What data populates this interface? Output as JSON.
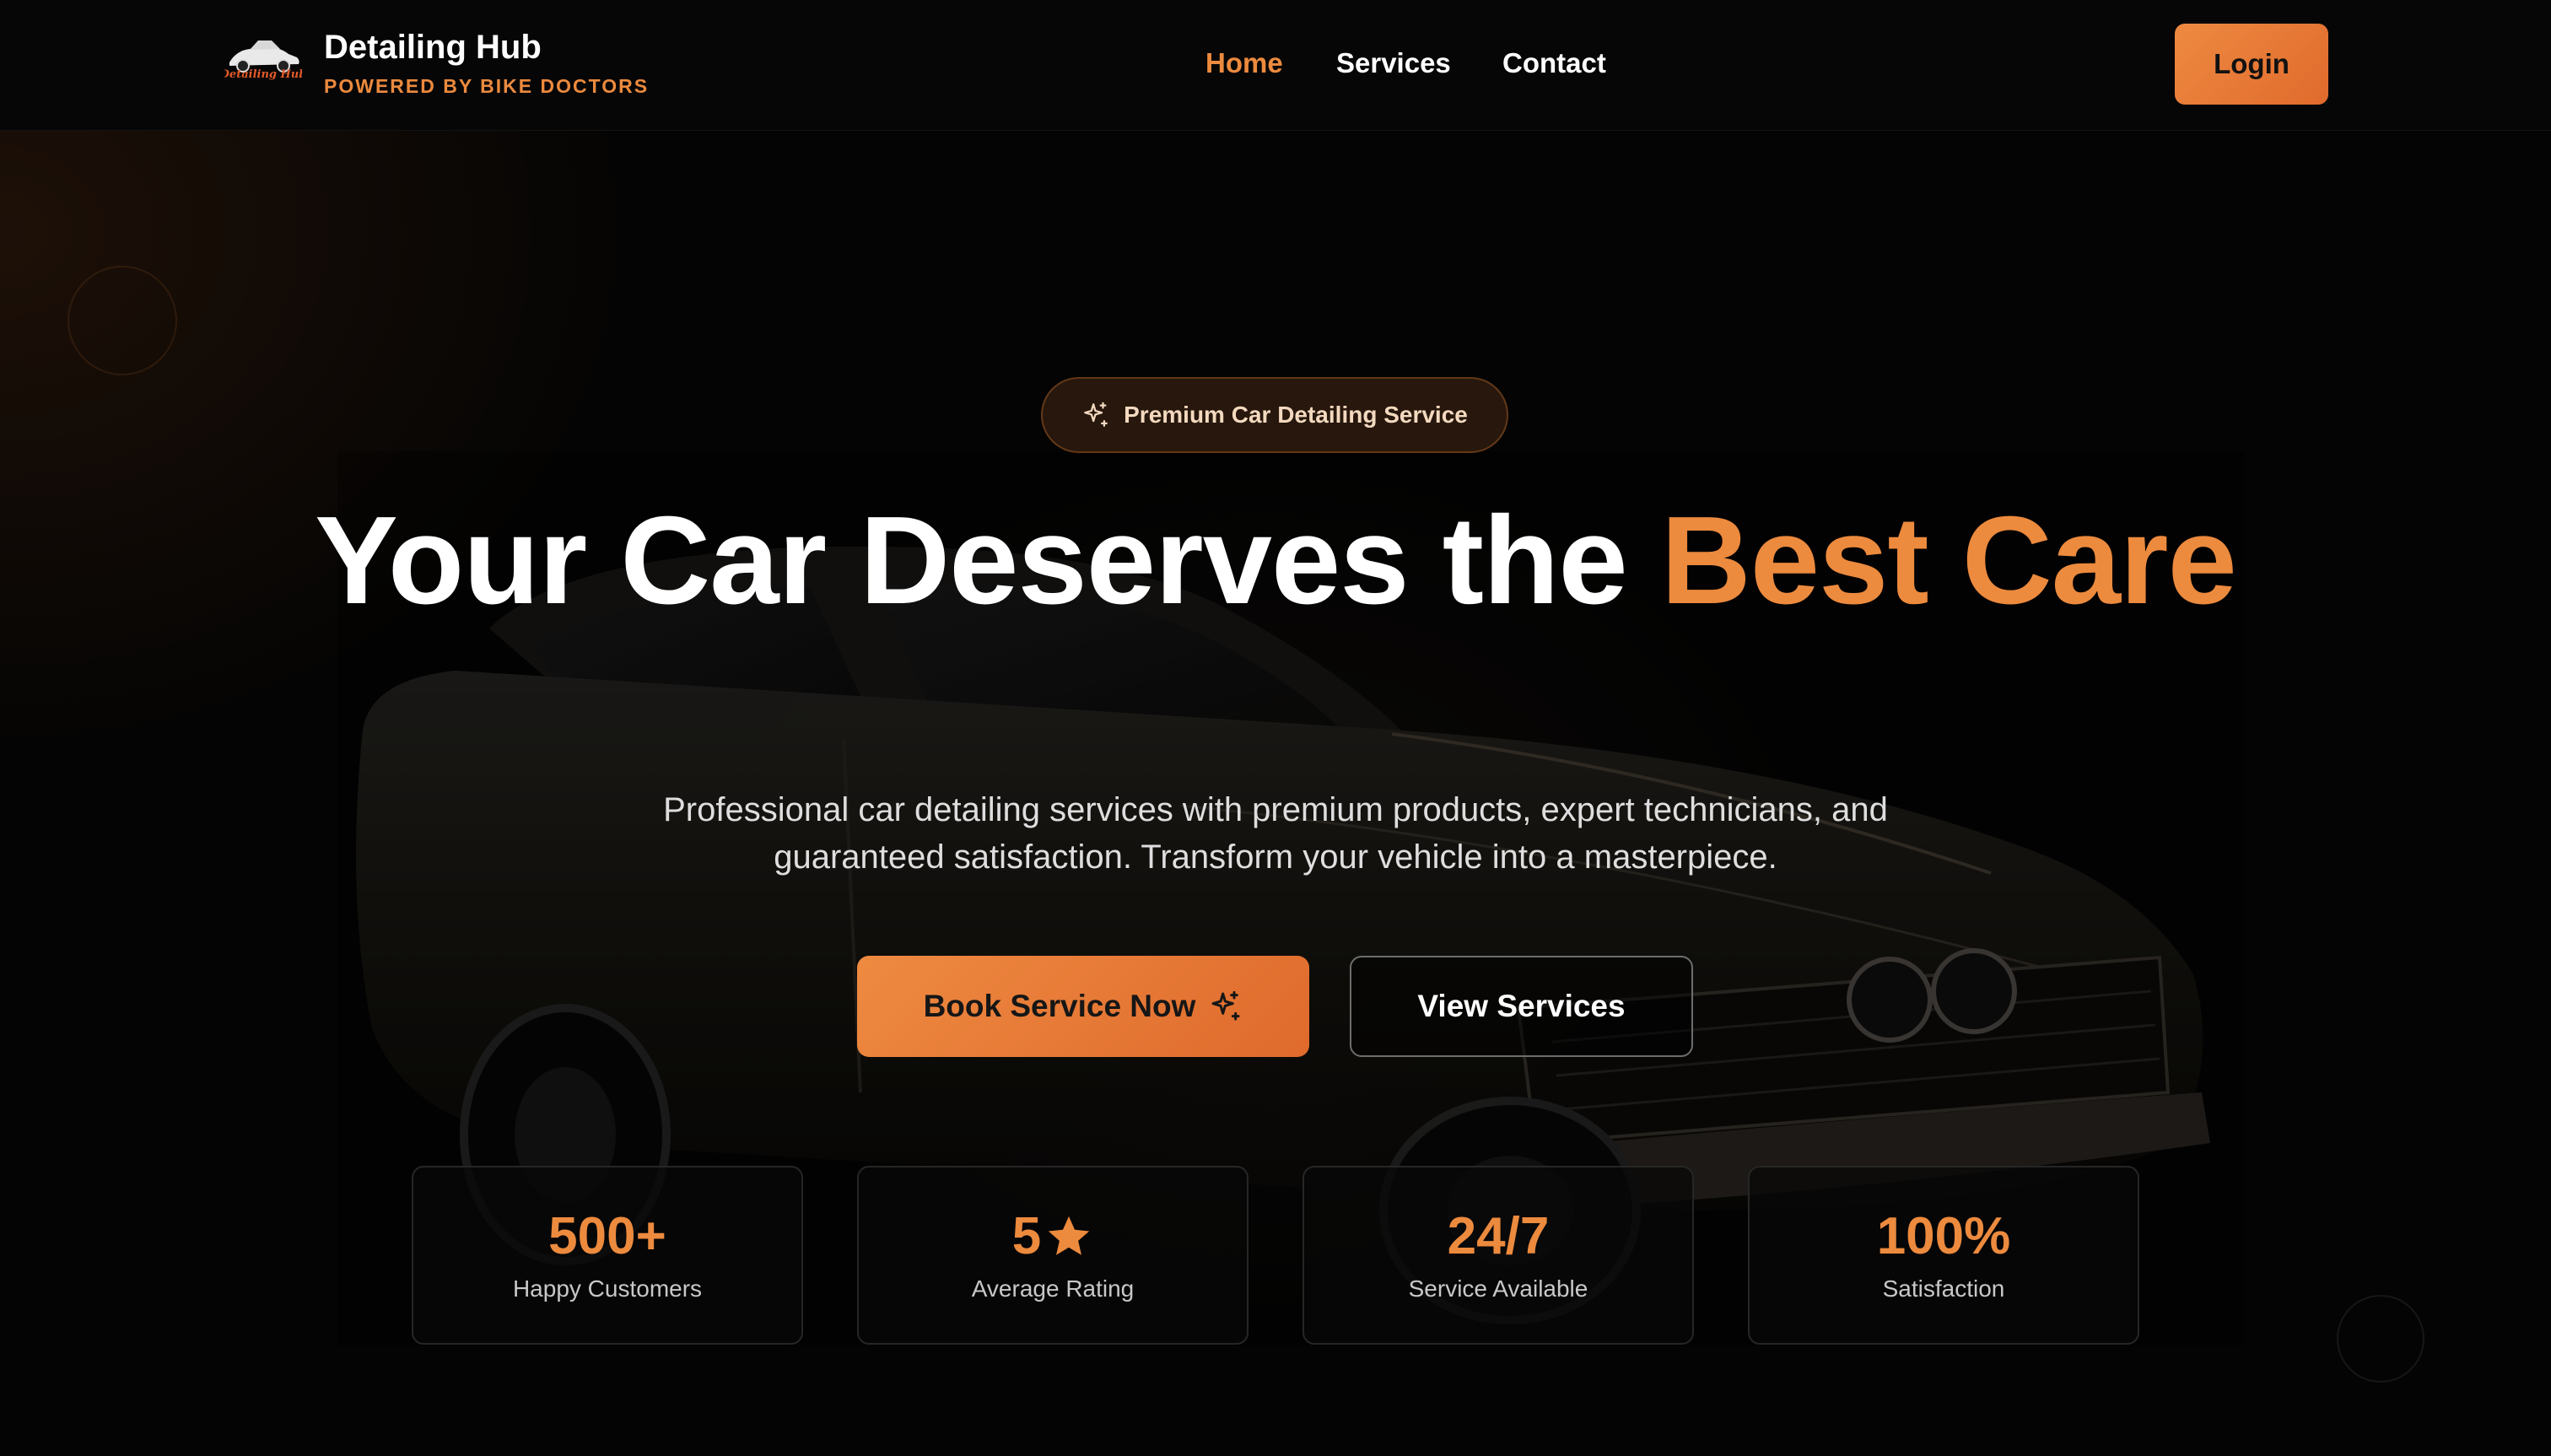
{
  "brand": {
    "name": "Detailing Hub",
    "tagline": "POWERED BY BIKE DOCTORS",
    "logo_icon": "car-logo-icon",
    "logo_text": "Detailing Hub"
  },
  "nav": {
    "links": [
      {
        "label": "Home",
        "active": true
      },
      {
        "label": "Services",
        "active": false
      },
      {
        "label": "Contact",
        "active": false
      }
    ],
    "login_label": "Login"
  },
  "hero": {
    "badge": {
      "icon": "sparkles-icon",
      "label": "Premium Car Detailing Service"
    },
    "headline_main": "Your Car Deserves the",
    "headline_accent": "Best Care",
    "description": "Professional car detailing services with premium products, expert technicians, and guaranteed satisfaction. Transform your vehicle into a masterpiece.",
    "primary_button": {
      "label": "Book Service Now",
      "icon": "sparkles-icon"
    },
    "secondary_button": {
      "label": "View Services"
    },
    "background_image": "classic-car-silhouette"
  },
  "stats": [
    {
      "value": "500+",
      "label": "Happy Customers"
    },
    {
      "value": "5",
      "value_icon": "star-icon",
      "label": "Average Rating"
    },
    {
      "value": "24/7",
      "label": "Service Available"
    },
    {
      "value": "100%",
      "label": "Satisfaction"
    }
  ],
  "colors": {
    "accent": "#ec8a3e",
    "background": "#040404",
    "text": "#ffffff"
  }
}
